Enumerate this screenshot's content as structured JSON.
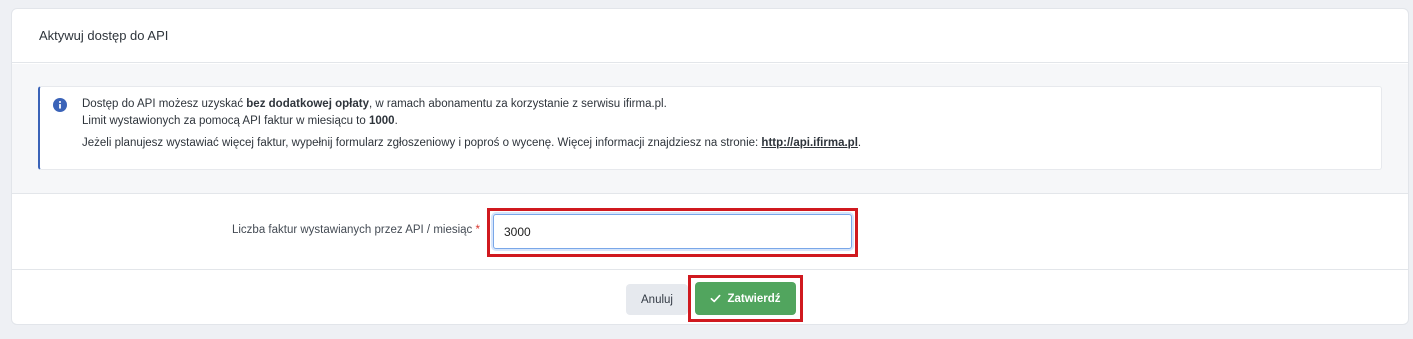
{
  "card": {
    "title": "Aktywuj dostęp do API"
  },
  "alert": {
    "icon": "info-icon",
    "line1_prefix": "Dostęp do API możesz uzyskać ",
    "line1_bold": "bez dodatkowej opłaty",
    "line1_suffix": ", w ramach abonamentu za korzystanie z serwisu ifirma.pl.",
    "line2_prefix": "Limit wystawionych za pomocą API faktur w miesiącu to ",
    "line2_bold": "1000",
    "line2_suffix": ".",
    "line3_prefix": "Jeżeli planujesz wystawiać więcej faktur, wypełnij formularz zgłoszeniowy i poproś o wycenę. Więcej informacji znajdziesz na stronie: ",
    "line3_link": "http://api.ifirma.pl",
    "line3_suffix": "."
  },
  "form": {
    "label": "Liczba faktur wystawianych przez API / miesiąc",
    "required_mark": "*",
    "value": "3000"
  },
  "footer": {
    "cancel_label": "Anuluj",
    "submit_label": "Zatwierdź",
    "submit_icon": "check-icon"
  },
  "colors": {
    "accent_blue": "#3a63b8",
    "submit_green": "#51a55e",
    "highlight_red": "#d0191f"
  }
}
